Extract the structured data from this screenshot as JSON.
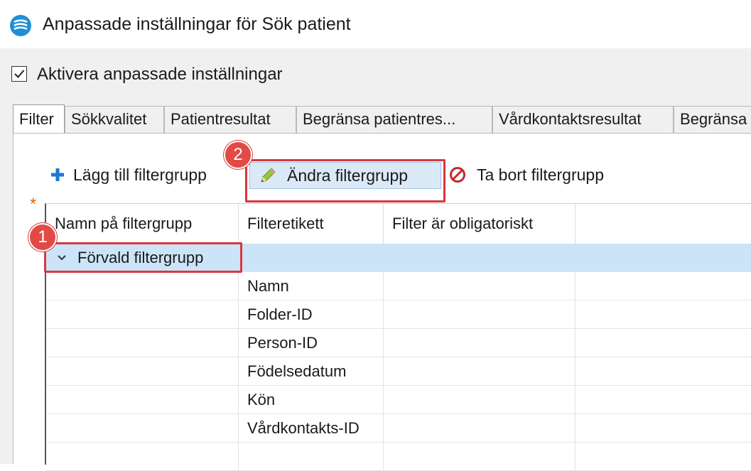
{
  "window": {
    "title": "Anpassade inställningar för Sök patient",
    "icon": "app-logo-icon"
  },
  "custom_settings": {
    "label": "Aktivera anpassade inställningar",
    "checked": true
  },
  "tabs": [
    {
      "label": "Filter",
      "active": true
    },
    {
      "label": "Sökkvalitet",
      "active": false
    },
    {
      "label": "Patientresultat",
      "active": false
    },
    {
      "label": "Begränsa patientres...",
      "active": false
    },
    {
      "label": "Vårdkontaktsresultat",
      "active": false
    },
    {
      "label": "Begränsa",
      "active": false
    }
  ],
  "toolbar": {
    "add_label": "Lägg till filtergrupp",
    "edit_label": "Ändra filtergrupp",
    "delete_label": "Ta bort filtergrupp"
  },
  "grid": {
    "required_marker": "*",
    "columns": [
      "Namn på filtergrupp",
      "Filteretikett",
      "Filter är obligatoriskt",
      ""
    ],
    "group": {
      "name": "Förvald filtergrupp",
      "expanded": true
    },
    "rows": [
      {
        "label": "Namn"
      },
      {
        "label": "Folder-ID"
      },
      {
        "label": "Person-ID"
      },
      {
        "label": "Födelsedatum"
      },
      {
        "label": "Kön"
      },
      {
        "label": "Vårdkontakts-ID"
      },
      {
        "label": ""
      }
    ]
  },
  "annotations": {
    "step1": "1",
    "step2": "2",
    "highlight_color": "#d9373d"
  },
  "colors": {
    "accent_add": "#1e78d2",
    "selection": "#cce4f7",
    "delete_icon": "#c6282d"
  }
}
